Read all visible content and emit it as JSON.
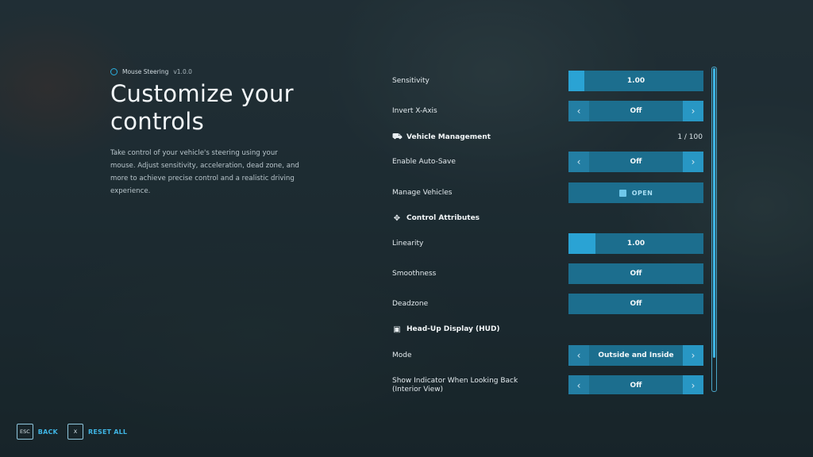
{
  "header": {
    "app_name": "Mouse Steering",
    "version": "v1.0.0",
    "title": "Customize your controls",
    "description": "Take control of your vehicle's steering using your mouse. Adjust sensitivity, acceleration, dead zone, and more to achieve precise control and a realistic driving experience."
  },
  "settings": {
    "sensitivity": {
      "label": "Sensitivity",
      "value": "1.00",
      "fill_fraction": 0.12
    },
    "invert_x": {
      "label": "Invert X-Axis",
      "value": "Off"
    },
    "vehicle_management": {
      "label": "Vehicle Management",
      "count": "1 / 100"
    },
    "auto_save": {
      "label": "Enable Auto-Save",
      "value": "Off"
    },
    "manage_vehicles": {
      "label": "Manage Vehicles",
      "button": "OPEN"
    },
    "control_attributes": {
      "label": "Control Attributes"
    },
    "linearity": {
      "label": "Linearity",
      "value": "1.00",
      "fill_fraction": 0.2
    },
    "smoothness": {
      "label": "Smoothness",
      "value": "Off"
    },
    "deadzone": {
      "label": "Deadzone",
      "value": "Off"
    },
    "hud": {
      "label": "Head-Up Display (HUD)"
    },
    "mode": {
      "label": "Mode",
      "value": "Outside and Inside"
    },
    "indicator_back": {
      "label": "Show Indicator When Looking Back (Interior View)",
      "value": "Off"
    }
  },
  "icons": {
    "arrow_left": "‹",
    "arrow_right": "›",
    "vehicle": "car-icon",
    "control": "move-icon",
    "hud": "display-icon"
  },
  "footer": {
    "back_key": "ESC",
    "back_label": "BACK",
    "reset_key": "X",
    "reset_label": "RESET ALL"
  },
  "colors": {
    "accent": "#2aa3d4",
    "control_bg": "#1c6e8e"
  }
}
